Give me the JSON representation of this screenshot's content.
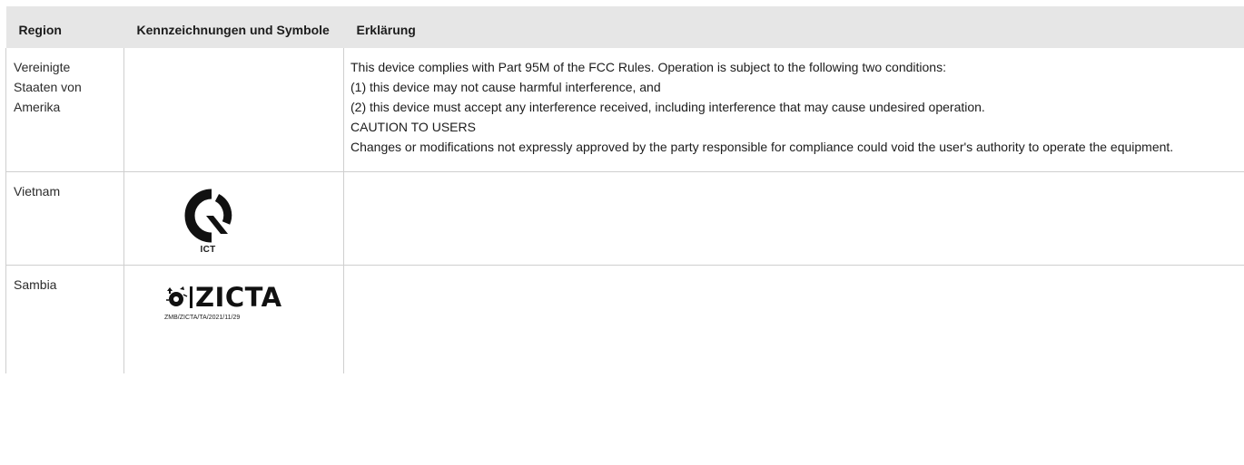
{
  "table": {
    "headers": {
      "region": "Region",
      "symbols": "Kennzeichnungen und Symbole",
      "explanation": "Erklärung"
    },
    "rows": [
      {
        "region": "Vereinigte Staaten von Amerika",
        "symbol": "",
        "explanation": [
          "This device complies with Part 95M of the FCC Rules. Operation is subject to the following two conditions:",
          "(1) this device may not cause harmful interference, and",
          "(2) this device must accept any interference received, including interference that may cause undesired operation.",
          "CAUTION TO USERS",
          "Changes or modifications not expressly approved by the party responsible for compliance could void the user's authority to operate the equipment."
        ]
      },
      {
        "region": "Vietnam",
        "symbol": "ict-mark-icon",
        "symbol_label": "ICT",
        "explanation": []
      },
      {
        "region": "Sambia",
        "symbol": "zicta-logo",
        "symbol_label": "ZICTA",
        "symbol_ref": "ZMB/ZICTA/TA/2021/11/29",
        "explanation": []
      }
    ]
  }
}
